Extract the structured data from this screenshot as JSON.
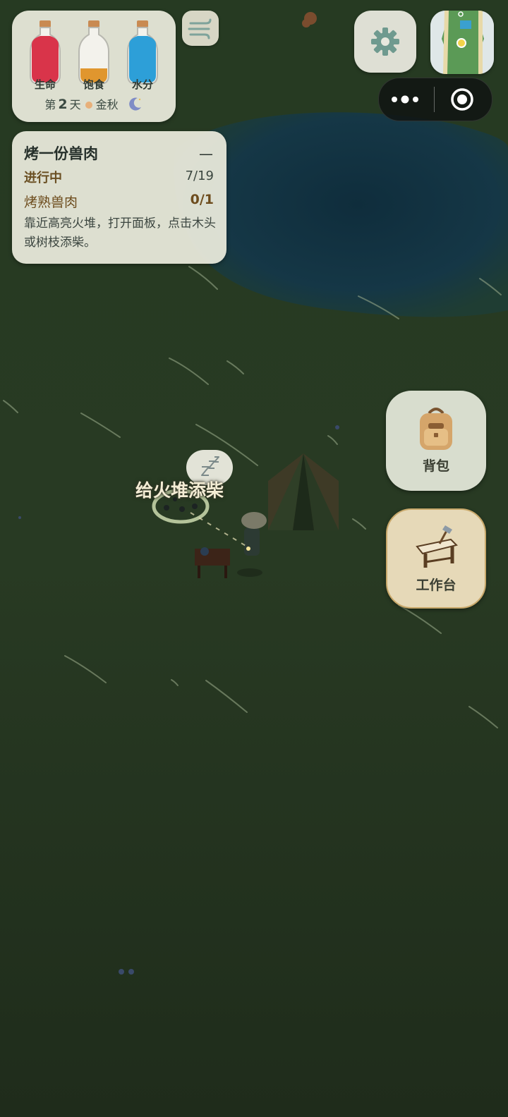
{
  "hud": {
    "bottles": [
      {
        "name": "生命",
        "icon": "health-potion-icon",
        "color": "#d9344a"
      },
      {
        "name": "饱食",
        "icon": "hunger-bottle-icon",
        "color": "#e0962e"
      },
      {
        "name": "水分",
        "icon": "water-bottle-icon",
        "color": "#2d9fd8"
      }
    ],
    "day_prefix": "第",
    "day_number": "2",
    "day_suffix": "天",
    "season": "金秋",
    "season_icon": "sun-dot-icon",
    "time_icon": "moon-icon"
  },
  "weather": {
    "icon": "wind-icon"
  },
  "quest": {
    "title": "烤一份兽肉",
    "collapse": "—",
    "status": "进行中",
    "page": "7/19",
    "objective": "烤熟兽肉",
    "count": "0/1",
    "description": "靠近高亮火堆，打开面板，点击木头或树枝添柴。"
  },
  "top_right": {
    "settings_icon": "gear-icon",
    "minimap_icon": "minimap-icon",
    "more_icon": "more-dots-icon",
    "close_icon": "record-circle-icon"
  },
  "actions": {
    "backpack": "背包",
    "workbench": "工作台"
  },
  "world": {
    "hint": "给火堆添柴",
    "sleep_icon": "zzz-icon"
  }
}
